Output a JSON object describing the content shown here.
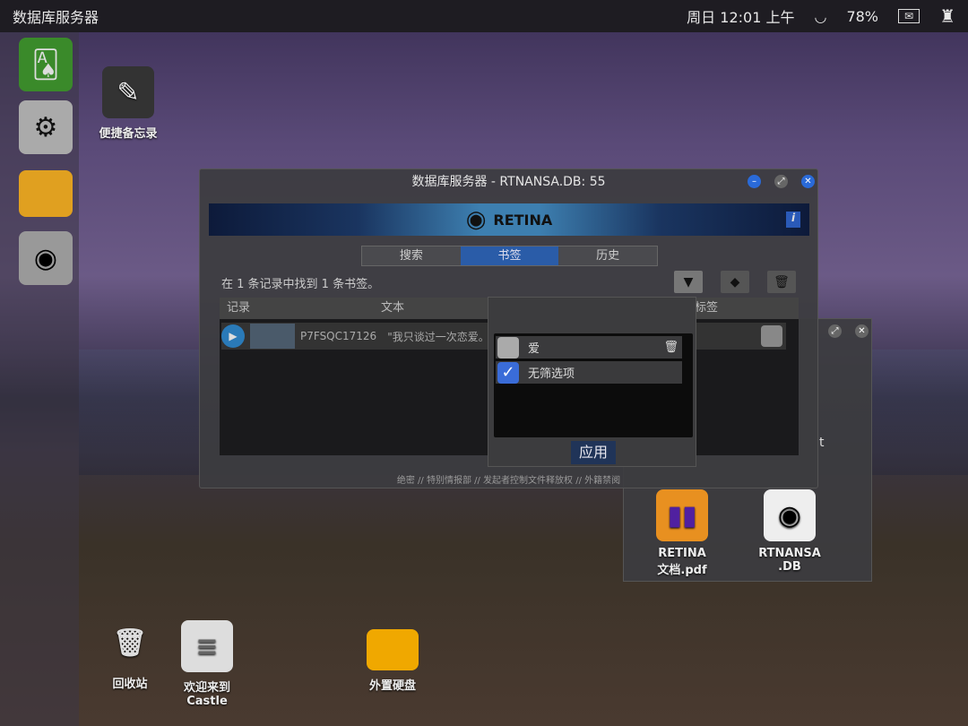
{
  "topbar": {
    "app_title": "数据库服务器",
    "datetime": "周日 12:01 上午",
    "battery": "78%"
  },
  "desktop": {
    "notes": "便捷备忘录",
    "trash": "回收站",
    "welcome_line1": "欢迎来到",
    "welcome_line2": "Castle",
    "external_drive": "外置硬盘"
  },
  "window": {
    "title": "数据库服务器 - RTNANSA.DB: 55",
    "brand": "RETINA",
    "tabs": [
      {
        "label": "搜索"
      },
      {
        "label": "书签"
      },
      {
        "label": "历史"
      }
    ],
    "status": "在 1 条记录中找到 1 条书签。",
    "columns": {
      "record": "记录",
      "text": "文本",
      "tags": "标签"
    },
    "row": {
      "id": "P7FSQC17126",
      "text": "\"我只谈过一次恋爱。"
    },
    "footer": "绝密 // 特别情报部 // 发起者控制文件释放权 // 外籍禁阅"
  },
  "filter_popup": {
    "items": [
      {
        "label": "爱",
        "checked": false
      },
      {
        "label": "无筛选项",
        "checked": true
      }
    ],
    "apply": "应用"
  },
  "files_window": {
    "partial": "t",
    "file1_line1": "RETINA",
    "file1_line2": "文档.pdf",
    "file2_line1": "RTNANSA",
    "file2_line2": ".DB"
  }
}
